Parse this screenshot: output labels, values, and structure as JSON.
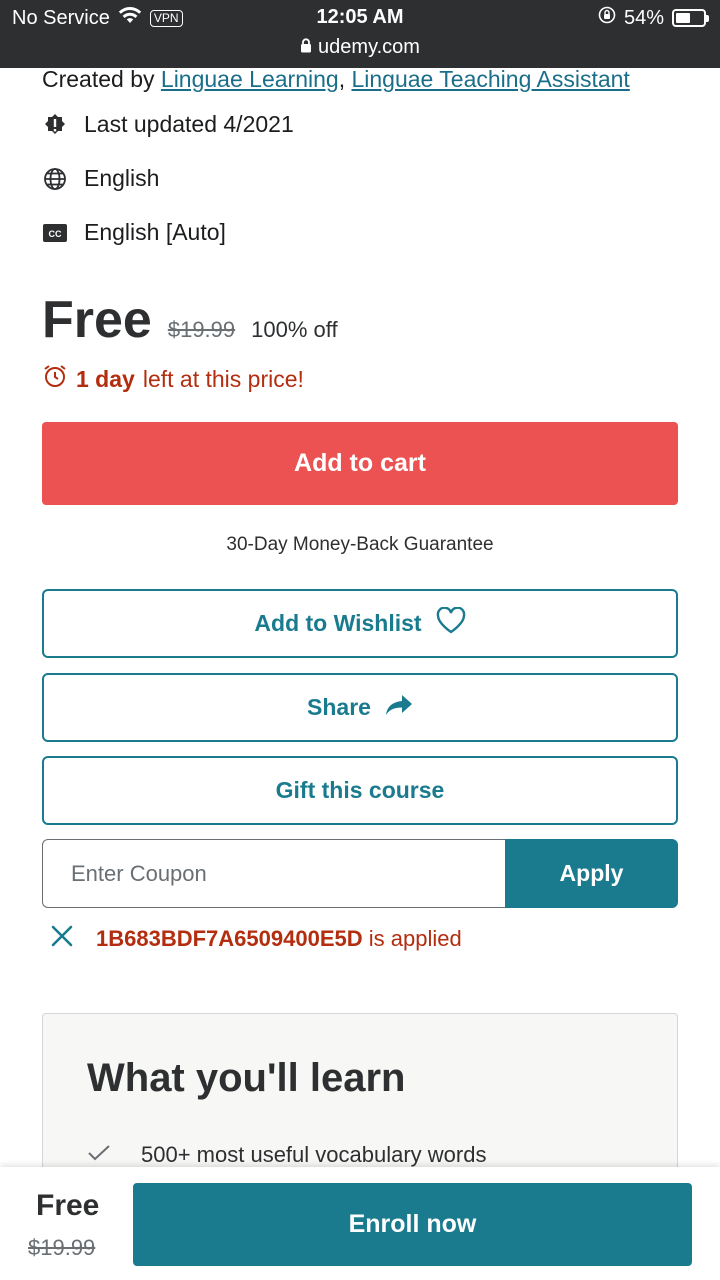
{
  "status_bar": {
    "carrier": "No Service",
    "vpn": "VPN",
    "time": "12:05 AM",
    "url": "udemy.com",
    "battery": "54%",
    "battery_level": 0.54
  },
  "course": {
    "created_by_label": "Created by",
    "authors": [
      "Linguae Learning",
      "Linguae Teaching Assistant"
    ],
    "author_separator": ",",
    "last_updated": "Last updated 4/2021",
    "language": "English",
    "captions": "English [Auto]"
  },
  "pricing": {
    "current": "Free",
    "original": "$19.99",
    "discount": "100% off",
    "time_left_bold": "1 day",
    "time_left_rest": "left at this price!"
  },
  "actions": {
    "add_to_cart": "Add to cart",
    "guarantee": "30-Day Money-Back Guarantee",
    "wishlist": "Add to Wishlist",
    "share": "Share",
    "gift": "Gift this course"
  },
  "coupon": {
    "placeholder": "Enter Coupon",
    "apply": "Apply",
    "applied_code": "1B683BDF7A6509400E5D",
    "applied_suffix": "is applied"
  },
  "learn": {
    "title": "What you'll learn",
    "items": [
      "500+ most useful vocabulary words"
    ]
  },
  "bottom_bar": {
    "price": "Free",
    "original": "$19.99",
    "enroll": "Enroll now"
  },
  "colors": {
    "accent_teal": "#1a7b8f",
    "cart_red": "#ec5252",
    "alert_red": "#b32d0f",
    "status_bar_bg": "#2d2f31"
  }
}
